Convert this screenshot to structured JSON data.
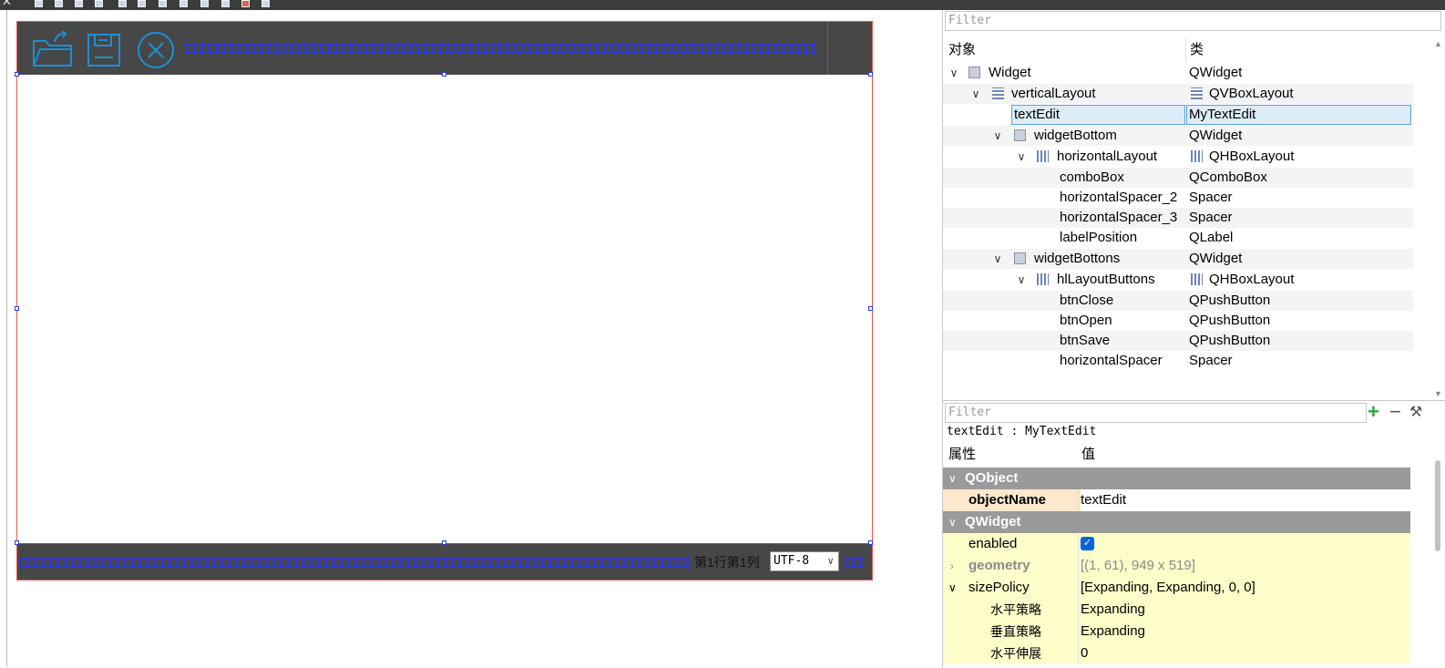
{
  "form": {
    "position_label": "第1行第1列",
    "encoding_value": "UTF-8"
  },
  "object_inspector": {
    "filter_placeholder": "Filter",
    "col_object": "对象",
    "col_class": "类",
    "rows": [
      {
        "name": "Widget",
        "class": "QWidget"
      },
      {
        "name": "verticalLayout",
        "class": "QVBoxLayout"
      },
      {
        "name": "textEdit",
        "class": "MyTextEdit"
      },
      {
        "name": "widgetBottom",
        "class": "QWidget"
      },
      {
        "name": "horizontalLayout",
        "class": "QHBoxLayout"
      },
      {
        "name": "comboBox",
        "class": "QComboBox"
      },
      {
        "name": "horizontalSpacer_2",
        "class": "Spacer"
      },
      {
        "name": "horizontalSpacer_3",
        "class": "Spacer"
      },
      {
        "name": "labelPosition",
        "class": "QLabel"
      },
      {
        "name": "widgetBottons",
        "class": "QWidget"
      },
      {
        "name": "hlLayoutButtons",
        "class": "QHBoxLayout"
      },
      {
        "name": "btnClose",
        "class": "QPushButton"
      },
      {
        "name": "btnOpen",
        "class": "QPushButton"
      },
      {
        "name": "btnSave",
        "class": "QPushButton"
      },
      {
        "name": "horizontalSpacer",
        "class": "Spacer"
      }
    ]
  },
  "property_editor": {
    "filter_placeholder": "Filter",
    "current_object": "textEdit : MyTextEdit",
    "col_property": "属性",
    "col_value": "值",
    "rows": [
      {
        "name": "QObject",
        "value": ""
      },
      {
        "name": "objectName",
        "value": "textEdit"
      },
      {
        "name": "QWidget",
        "value": ""
      },
      {
        "name": "enabled",
        "value": ""
      },
      {
        "name": "geometry",
        "value": "[(1, 61), 949 x 519]"
      },
      {
        "name": "sizePolicy",
        "value": "[Expanding, Expanding, 0, 0]"
      },
      {
        "name": "水平策略",
        "value": "Expanding"
      },
      {
        "name": "垂直策略",
        "value": "Expanding"
      },
      {
        "name": "水平伸展",
        "value": "0"
      }
    ],
    "enabled_checked": true
  },
  "colors": {
    "toolbar_bg": "#3c3c3c",
    "bar_bg": "#474747",
    "icon_blue": "#1a8fd6",
    "spacer_blue": "#2c36d8",
    "selection": "#dcedf9",
    "group_header": "#9a9a9a",
    "property_yellow": "#fefecb"
  }
}
